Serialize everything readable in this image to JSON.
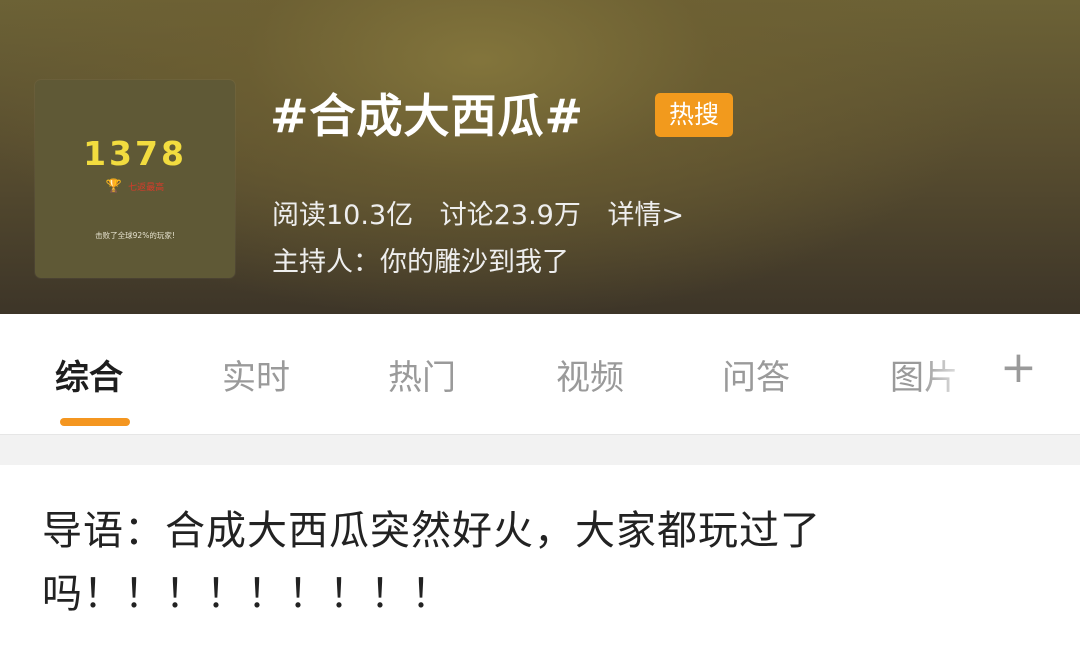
{
  "topic": {
    "title": "#合成大西瓜#",
    "badge": "热搜",
    "reads": "阅读10.3亿",
    "discussions": "讨论23.9万",
    "details_link": "详情>",
    "host": "主持人：你的雕沙到我了"
  },
  "thumbnail": {
    "score": "1378",
    "best_label": "七返最高",
    "beat_text": "击败了全球92%的玩家!"
  },
  "tabs": [
    {
      "label": "综合",
      "active": true
    },
    {
      "label": "实时",
      "active": false
    },
    {
      "label": "热门",
      "active": false
    },
    {
      "label": "视频",
      "active": false
    },
    {
      "label": "问答",
      "active": false
    },
    {
      "label": "图片",
      "active": false
    }
  ],
  "colors": {
    "accent": "#f49620",
    "badge": "#f29a1d",
    "score": "#f2dc3f"
  },
  "intro": {
    "text": "导语：合成大西瓜突然好火，大家都玩过了吗！！！！！！！！！"
  }
}
